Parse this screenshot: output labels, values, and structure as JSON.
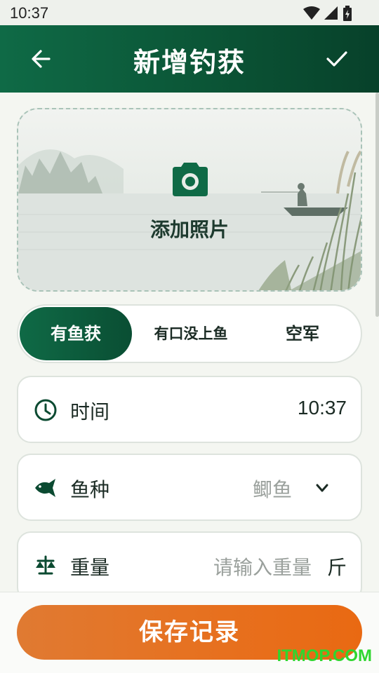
{
  "status_bar": {
    "time": "10:37"
  },
  "app_bar": {
    "title": "新增钓获"
  },
  "photo": {
    "label": "添加照片"
  },
  "segments": [
    {
      "label": "有鱼获",
      "active": true
    },
    {
      "label": "有口没上鱼",
      "active": false
    },
    {
      "label": "空军",
      "active": false
    }
  ],
  "fields": {
    "time": {
      "label": "时间",
      "value": "10:37"
    },
    "species": {
      "label": "鱼种",
      "value": "鲫鱼"
    },
    "weight": {
      "label": "重量",
      "placeholder": "请输入重量",
      "unit": "斤"
    }
  },
  "save_button": {
    "label": "保存记录"
  },
  "watermark": "ITMOP.COM",
  "icons": [
    "arrow-left-icon",
    "check-icon",
    "camera-icon",
    "clock-icon",
    "fish-icon",
    "chevron-down-icon",
    "scale-icon",
    "wifi-icon",
    "signal-icon",
    "battery-icon"
  ],
  "colors": {
    "primary": "#0f6a46",
    "accent": "#e7701e",
    "text": "#1b2b24",
    "placeholder": "#9aa09c"
  }
}
